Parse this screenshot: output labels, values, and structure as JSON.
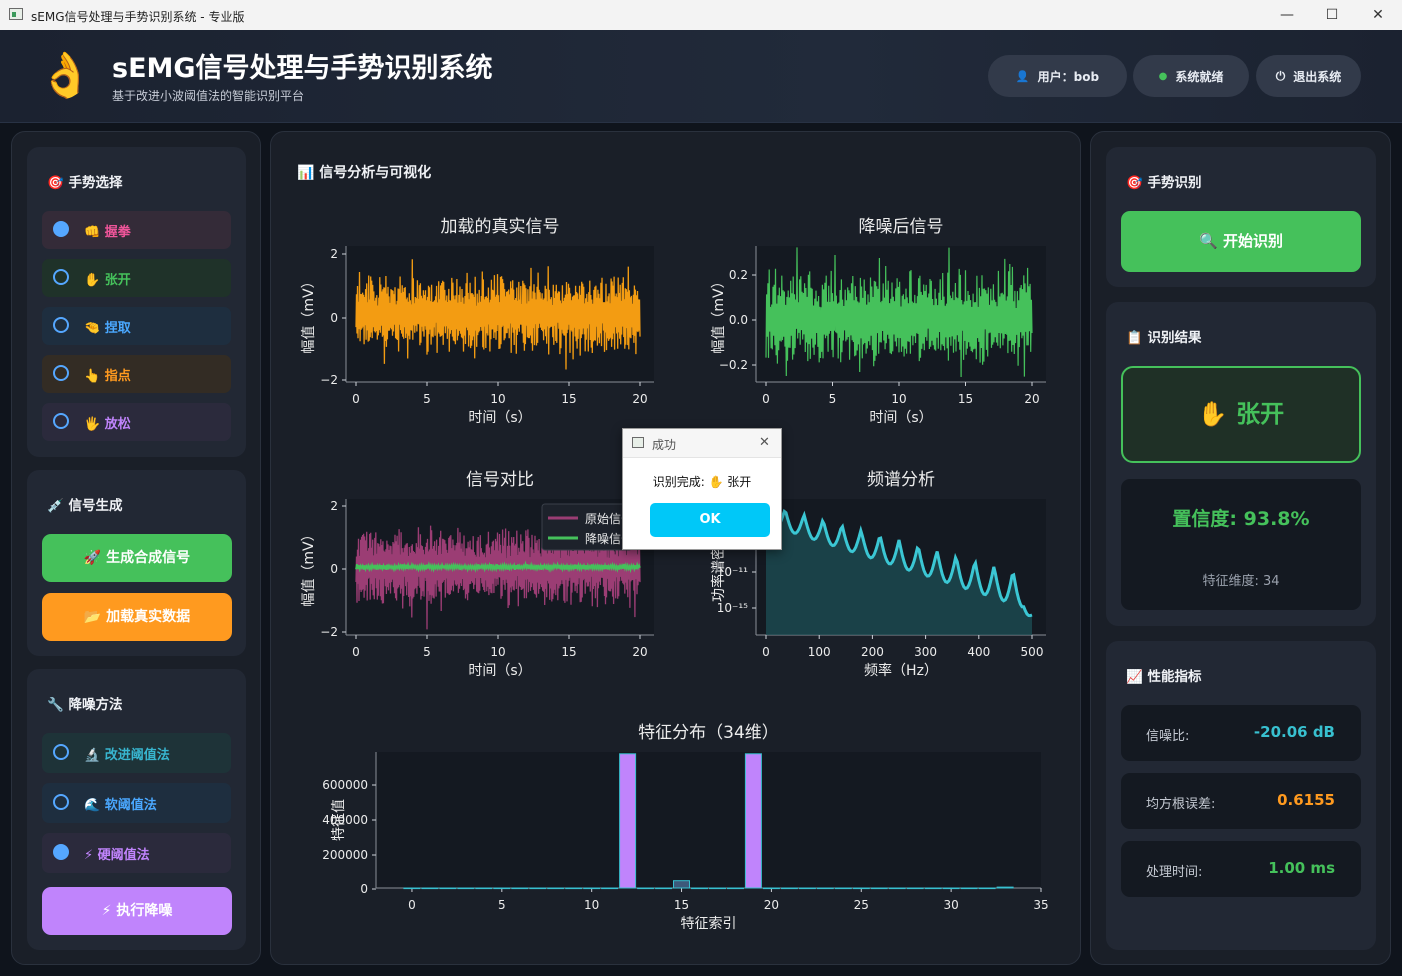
{
  "window": {
    "title": "sEMG信号处理与手势识别系统 - 专业版",
    "minimize": "—",
    "maximize": "☐",
    "close": "✕"
  },
  "header": {
    "logo": "👌",
    "title": "sEMG信号处理与手势识别系统",
    "subtitle": "基于改进小波阈值法的智能识别平台",
    "user_icon": "👤",
    "user": "用户：bob",
    "status_icon": "●",
    "status": "系统就绪",
    "logout_icon": "⏻",
    "logout": "退出系统"
  },
  "left": {
    "gesture_title": "🎯 手势选择",
    "gestures": [
      {
        "label": "👊 握拳",
        "color": "#f0559a",
        "selected": true
      },
      {
        "label": "✋ 张开",
        "color": "#45c15b",
        "selected": false
      },
      {
        "label": "🤏 捏取",
        "color": "#4aa8ff",
        "selected": false
      },
      {
        "label": "👆 指点",
        "color": "#ff9a1f",
        "selected": false
      },
      {
        "label": "🖐 放松",
        "color": "#c084fc",
        "selected": false
      }
    ],
    "signal_title": "💉 信号生成",
    "gen_button": "🚀 生成合成信号",
    "load_button": "📂 加载真实数据",
    "denoise_title": "🔧 降噪方法",
    "methods": [
      {
        "label": "🔬 改进阈值法",
        "color": "#38b6d0",
        "selected": false
      },
      {
        "label": "🌊 软阈值法",
        "color": "#4aa8ff",
        "selected": false
      },
      {
        "label": "⚡ 硬阈值法",
        "color": "#c084fc",
        "selected": true
      }
    ],
    "run_button": "⚡ 执行降噪"
  },
  "center": {
    "title": "📊 信号分析与可视化"
  },
  "chart_data": [
    {
      "type": "line",
      "title": "加载的真实信号",
      "xlabel": "时间（s）",
      "ylabel": "幅值（mV）",
      "xticks": [
        "0",
        "5",
        "10",
        "15",
        "20"
      ],
      "yticks": [
        "2",
        "0",
        "−2"
      ],
      "xlim": [
        0,
        20
      ],
      "ylim": [
        -2.2,
        2.2
      ],
      "amplitude": 1.4,
      "series": [
        {
          "color": "#f39c12"
        }
      ]
    },
    {
      "type": "line",
      "title": "降噪后信号",
      "xlabel": "时间（s）",
      "ylabel": "幅值（mV）",
      "xticks": [
        "0",
        "5",
        "10",
        "15",
        "20"
      ],
      "yticks": [
        "0.2",
        "0.0",
        "−0.2"
      ],
      "xlim": [
        0,
        20
      ],
      "ylim": [
        -0.27,
        0.3
      ],
      "amplitude": 0.1,
      "series": [
        {
          "color": "#45c15b"
        }
      ]
    },
    {
      "type": "line",
      "title": "信号对比",
      "xlabel": "时间（s）",
      "ylabel": "幅值（mV）",
      "xticks": [
        "0",
        "5",
        "10",
        "15",
        "20"
      ],
      "yticks": [
        "2",
        "0",
        "−2"
      ],
      "xlim": [
        0,
        20
      ],
      "ylim": [
        -2.2,
        2.2
      ],
      "legend_position": "top-right",
      "series": [
        {
          "name": "原始信号",
          "color": "#9b3d74",
          "amplitude": 1.4
        },
        {
          "name": "降噪信号",
          "color": "#45c15b",
          "amplitude": 0.1
        }
      ]
    },
    {
      "type": "area",
      "title": "频谱分析",
      "xlabel": "频率（Hz）",
      "ylabel": "功率谱密度",
      "xticks": [
        "0",
        "100",
        "200",
        "300",
        "400",
        "500"
      ],
      "yticks": [
        "10⁻¹¹",
        "10⁻¹⁵"
      ],
      "xlim": [
        0,
        500
      ],
      "series": [
        {
          "color": "#3bc7d4"
        }
      ]
    },
    {
      "type": "bar",
      "title": "特征分布（34维）",
      "xlabel": "特征索引",
      "ylabel": "特征值",
      "xticks": [
        "0",
        "5",
        "10",
        "15",
        "20",
        "25",
        "30",
        "35"
      ],
      "yticks": [
        "600000",
        "400000",
        "200000",
        "0"
      ],
      "xlim": [
        -2,
        35
      ],
      "ylim": [
        0,
        750000
      ],
      "categories": [
        0,
        1,
        2,
        3,
        4,
        5,
        6,
        7,
        8,
        9,
        10,
        11,
        12,
        13,
        14,
        15,
        16,
        17,
        18,
        19,
        20,
        21,
        22,
        23,
        24,
        25,
        26,
        27,
        28,
        29,
        30,
        31,
        32,
        33
      ],
      "values": [
        0,
        0,
        0,
        0,
        0,
        0,
        0,
        0,
        0,
        0,
        0,
        0,
        740000,
        0,
        0,
        40000,
        0,
        0,
        0,
        740000,
        0,
        0,
        0,
        0,
        0,
        0,
        0,
        0,
        0,
        0,
        0,
        0,
        0,
        5000
      ]
    }
  ],
  "right": {
    "recog_title": "🎯 手势识别",
    "start_button": "🔍 开始识别",
    "result_title": "📋 识别结果",
    "result": "✋ 张开",
    "confidence": "置信度: 93.8%",
    "feature_dim": "特征维度: 34",
    "metrics_title": "📈 性能指标",
    "metrics": [
      {
        "label": "信噪比:",
        "value": "-20.06 dB",
        "color": "#38c0d0"
      },
      {
        "label": "均方根误差:",
        "value": "0.6155",
        "color": "#ff9a1f"
      },
      {
        "label": "处理时间:",
        "value": "1.00 ms",
        "color": "#45c15b"
      }
    ]
  },
  "dialog": {
    "title": "成功",
    "message": "识别完成: ✋ 张开",
    "ok": "OK",
    "close": "✕"
  }
}
